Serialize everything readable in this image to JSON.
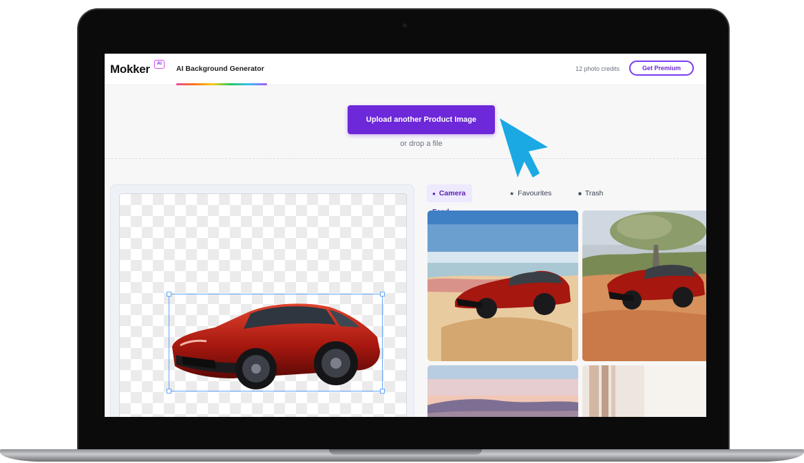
{
  "app": {
    "logo": "Mokker",
    "logo_badge": "AI",
    "active_tab": "AI Background Generator",
    "credits": "12 photo credits",
    "premium_button": "Get Premium"
  },
  "upload": {
    "button_label": "Upload another Product Image",
    "drop_text": "or drop a file"
  },
  "feed": {
    "tabs": [
      {
        "label": "Camera Feed",
        "icon": "camera-icon",
        "active": true
      },
      {
        "label": "Favourites",
        "icon": "star-icon",
        "active": false
      },
      {
        "label": "Trash",
        "icon": "trash-icon",
        "active": false
      }
    ],
    "images": [
      {
        "name": "car-on-beach",
        "scene": "beach"
      },
      {
        "name": "car-in-desert-savanna",
        "scene": "savanna"
      },
      {
        "name": "car-with-mountain-sunset",
        "scene": "mountain"
      },
      {
        "name": "car-with-curtain",
        "scene": "curtain"
      }
    ]
  },
  "colors": {
    "brand_purple": "#6d28d9",
    "cursor_blue": "#1aa9e3"
  }
}
